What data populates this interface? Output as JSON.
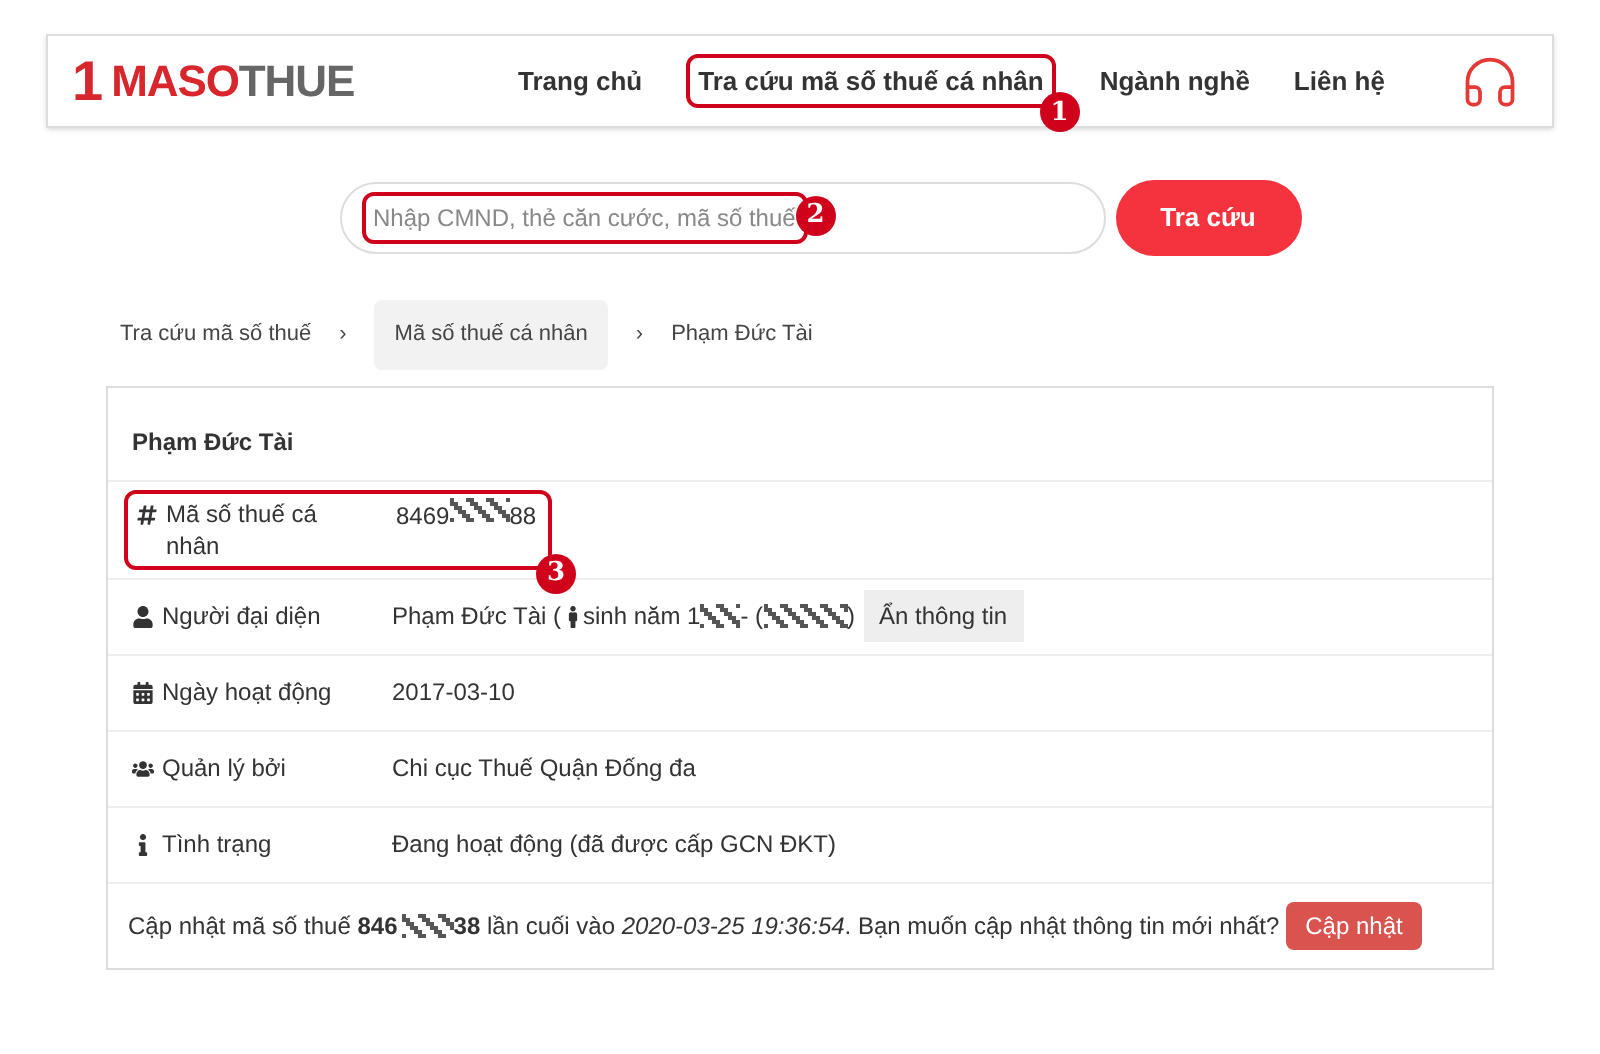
{
  "header": {
    "logo": {
      "mark": "1",
      "brand_red": "MASO",
      "brand_gray": "THUE"
    },
    "nav": [
      {
        "label": "Trang chủ"
      },
      {
        "label": "Tra cứu mã số thuế cá nhân",
        "annotation": "1"
      },
      {
        "label": "Ngành nghề"
      },
      {
        "label": "Liên hệ"
      }
    ]
  },
  "search": {
    "placeholder": "Nhập CMND, thẻ căn cước, mã số thuế",
    "annotation": "2",
    "button": "Tra cứu"
  },
  "breadcrumb": [
    {
      "label": "Tra cứu mã số thuế",
      "separator": "›",
      "highlighted": false
    },
    {
      "label": "Mã số thuế cá nhân",
      "separator": "›",
      "highlighted": true
    },
    {
      "label": "Phạm Đức Tài",
      "highlighted": false
    }
  ],
  "card": {
    "title": "Phạm Đức Tài",
    "rows": [
      {
        "kind": "tax_id",
        "label": "Mã số thuế cá nhân",
        "value_start": "8469",
        "value_end": "88",
        "annotation": "3"
      },
      {
        "kind": "person",
        "label": "Người đại diện",
        "name": "Phạm Đức Tài (",
        "birth": "sinh năm 1",
        "dash": "- (",
        "close": ")",
        "button": "Ẩn thông tin"
      },
      {
        "kind": "text",
        "label": "Ngày hoạt động",
        "value": "2017-03-10"
      },
      {
        "kind": "text",
        "label": "Quản lý bởi",
        "value": "Chi cục Thuế Quận Đống đa"
      },
      {
        "kind": "text",
        "label": "Tình trạng",
        "value": "Đang hoạt động (đã được cấp GCN ĐKT)"
      }
    ],
    "footer": {
      "before": "Cập nhật mã số thuế **846**",
      "after": "**38** lần cuối vào *2020-03-25 19:36:54*. Bạn muốn cập nhật thông tin mới nhất?",
      "button": "Cập nhật"
    }
  }
}
